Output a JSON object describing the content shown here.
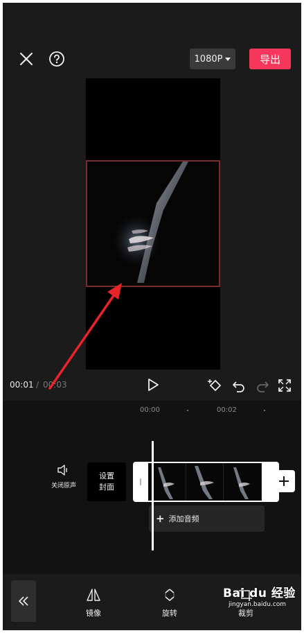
{
  "header": {
    "resolution_label": "1080P",
    "export_label": "导出"
  },
  "player": {
    "current_time": "00:01",
    "separator": "/",
    "total_time": "00:03"
  },
  "timeline": {
    "ticks": [
      "00:00",
      "00:02"
    ],
    "mute_label": "关闭原声",
    "cover_line1": "设置",
    "cover_line2": "封面",
    "add_audio_label": "添加音频"
  },
  "toolbar": {
    "tools": [
      {
        "icon": "mirror-icon",
        "label": "镜像"
      },
      {
        "icon": "rotate-icon",
        "label": "旋转"
      },
      {
        "icon": "crop-icon",
        "label": "裁剪"
      }
    ]
  },
  "watermark": {
    "brand": "Bai du 经验",
    "url": "jingyan.baidu.com"
  },
  "colors": {
    "background": "#1b1b1b",
    "export_accent": "#f6365a",
    "annotation_arrow": "#e8232a",
    "frame_border": "#7a2b2e"
  }
}
